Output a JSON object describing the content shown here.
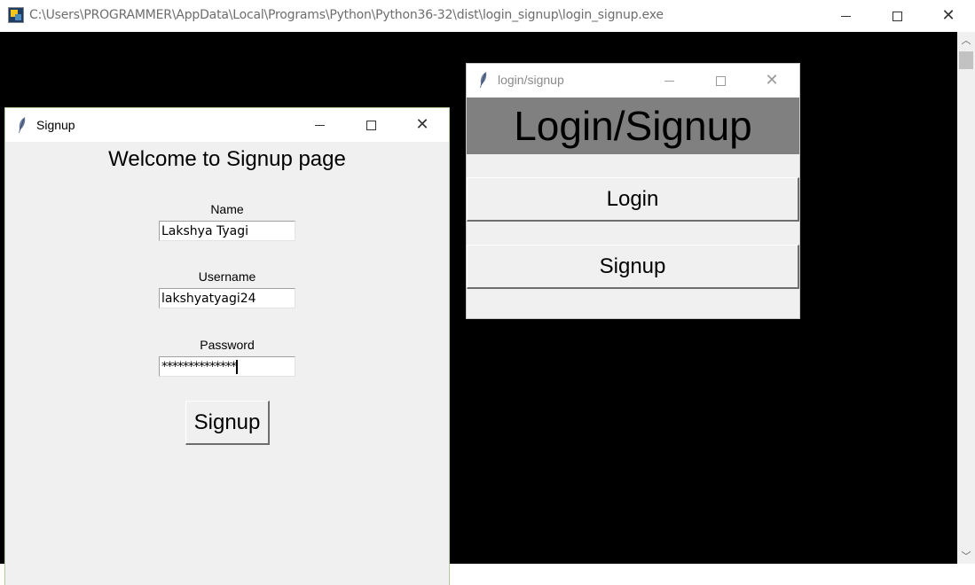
{
  "console_window": {
    "title": "C:\\Users\\PROGRAMMER\\AppData\\Local\\Programs\\Python\\Python36-32\\dist\\login_signup\\login_signup.exe",
    "app_icon": "python-app-icon",
    "controls": {
      "minimize": "minimize-icon",
      "maximize": "maximize-icon",
      "close": "close-icon"
    },
    "background_color": "#000000"
  },
  "login_window": {
    "title": "login/signup",
    "icon": "tk-feather-icon",
    "header": "Login/Signup",
    "header_bg": "#808080",
    "buttons": {
      "login": "Login",
      "signup": "Signup"
    }
  },
  "signup_window": {
    "title": "Signup",
    "icon": "tk-feather-icon",
    "welcome": "Welcome to Signup page",
    "fields": {
      "name": {
        "label": "Name",
        "value": "Lakshya Tyagi"
      },
      "username": {
        "label": "Username",
        "value": "lakshyatyagi24"
      },
      "password": {
        "label": "Password",
        "value": "**************"
      }
    },
    "submit_label": "Signup"
  }
}
